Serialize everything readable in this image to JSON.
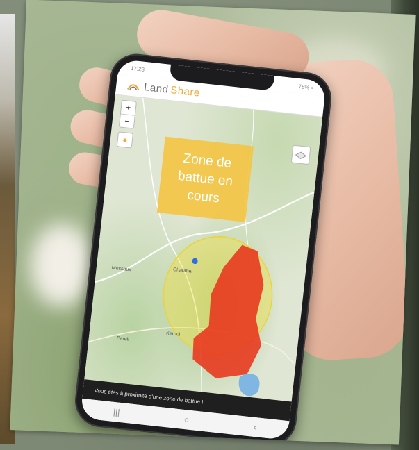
{
  "phone": {
    "status_time": "17:23",
    "status_right": "78% ▪",
    "app_name_part1": "Land",
    "app_name_part2": "Share"
  },
  "map": {
    "zoom_in": "+",
    "zoom_out": "−",
    "banner_line1": "Zone de",
    "banner_line2": "battue en",
    "banner_line3": "cours",
    "places": [
      "Mussaux",
      "Chaumel",
      "Kerdol",
      "Pareil"
    ]
  },
  "notice": {
    "text": "Vous êtes à proximité d'une zone de battue !"
  },
  "navbar": {
    "recent": "|||",
    "home": "○",
    "back": "‹"
  },
  "colors": {
    "brand_accent": "#f0a93a",
    "banner_yellow": "#f4c442",
    "hunt_zone_red": "#e83a1f",
    "proximity_yellow": "#f1e04a"
  }
}
